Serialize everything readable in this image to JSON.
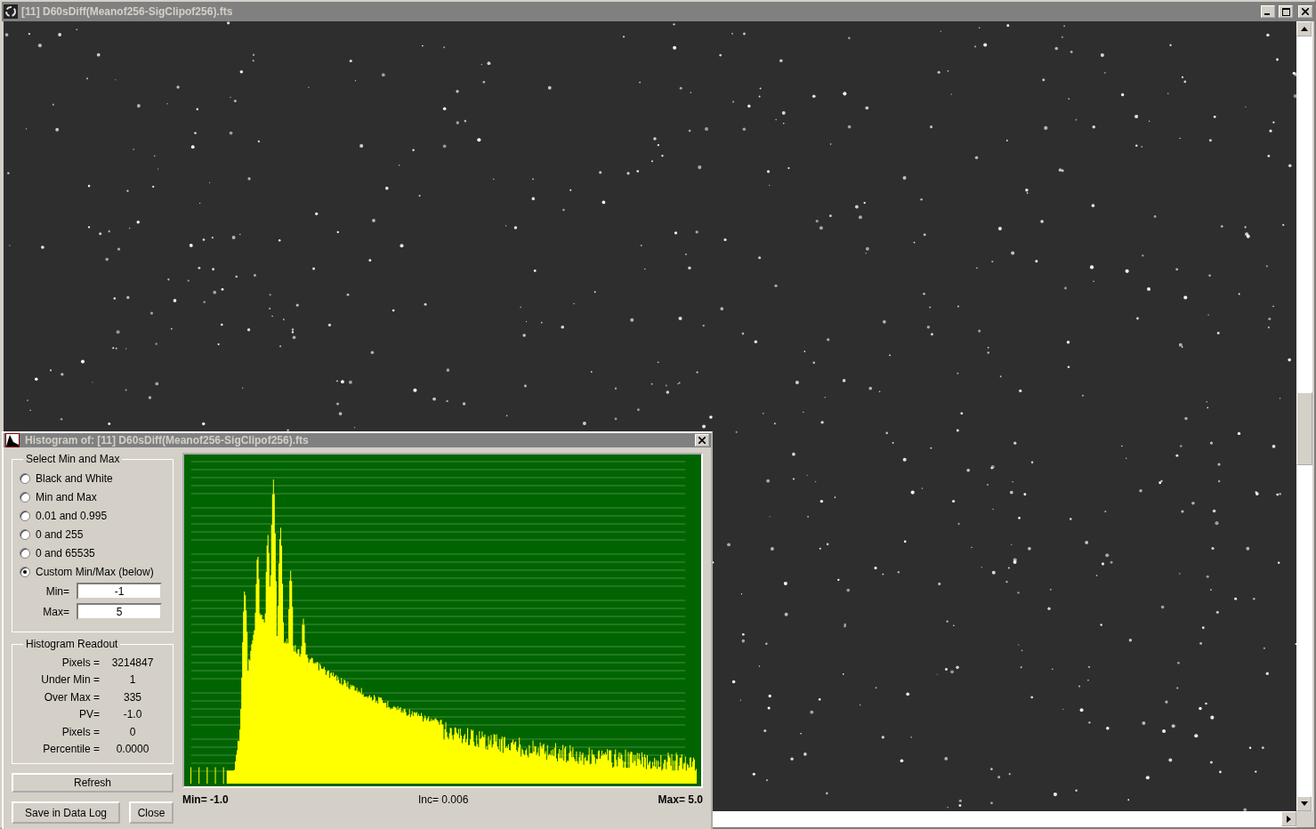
{
  "window": {
    "title": "[11] D60sDiff(Meanof256-SigClipof256).fts"
  },
  "histogram_dialog": {
    "title": "Histogram of:  [11] D60sDiff(Meanof256-SigClipof256).fts",
    "select_group": {
      "label": "Select Min and Max",
      "options": [
        {
          "label": "Black and White",
          "selected": false
        },
        {
          "label": "Min and Max",
          "selected": false
        },
        {
          "label": "0.01 and 0.995",
          "selected": false
        },
        {
          "label": "0 and 255",
          "selected": false
        },
        {
          "label": "0 and 65535",
          "selected": false
        },
        {
          "label": "Custom Min/Max (below)",
          "selected": true
        }
      ],
      "fields": [
        {
          "label": "Min=",
          "value": "-1"
        },
        {
          "label": "Max=",
          "value": "5"
        }
      ]
    },
    "readout": {
      "label": "Histogram Readout",
      "rows": [
        {
          "label": "Pixels =",
          "value": "3214847"
        },
        {
          "label": "Under Min =",
          "value": "1"
        },
        {
          "label": "Over Max =",
          "value": "335"
        },
        {
          "label": "PV=",
          "value": "-1.0"
        },
        {
          "label": "Pixels =",
          "value": "0"
        },
        {
          "label": "Percentile =",
          "value": "0.0000"
        }
      ]
    },
    "refresh_button": "Refresh",
    "save_button": "Save in Data Log",
    "close_button": "Close",
    "chart": {
      "min_label": "Min= -1.0",
      "inc_label": "Inc= 0.006",
      "max_label": "Max= 5.0"
    }
  }
}
